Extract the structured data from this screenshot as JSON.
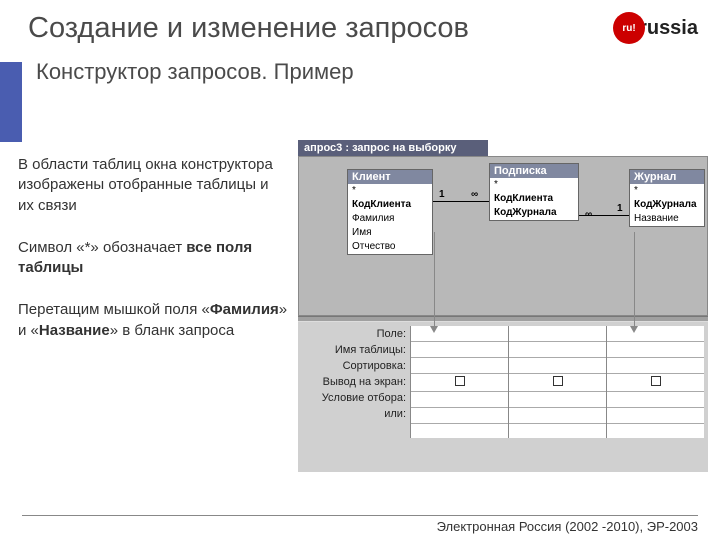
{
  "title": "Создание и изменение запросов",
  "subtitle": "Конструктор запросов. Пример",
  "logo": {
    "ball": "ru!",
    "text": "russia"
  },
  "left": {
    "p1": "В области таблиц окна конструктора изображены отобранные таблицы и их связи",
    "p2_a": "Символ «*» обозначает ",
    "p2_b": "все поля таблицы",
    "p3_a": "Перетащим мышкой  поля «",
    "p3_b": "Фамилия",
    "p3_c": "» и «",
    "p3_d": "Название",
    "p3_e": "» в бланк запроса"
  },
  "query_title": "апрос3 : запрос на выборку",
  "tables": {
    "t1": {
      "name": "Клиент",
      "fields": [
        "*",
        "КодКлиента",
        "Фамилия",
        "Имя",
        "Отчество"
      ]
    },
    "t2": {
      "name": "Подписка",
      "fields": [
        "*",
        "КодКлиента",
        "КодЖурнала"
      ]
    },
    "t3": {
      "name": "Журнал",
      "fields": [
        "*",
        "КодЖурнала",
        "Название"
      ]
    }
  },
  "rel": {
    "one": "1",
    "many": "∞"
  },
  "grid_labels": [
    "Поле:",
    "Имя таблицы:",
    "Сортировка:",
    "Вывод на экран:",
    "Условие отбора:",
    "или:"
  ],
  "footer": "Электронная Россия (2002 -2010), ЭР-2003"
}
